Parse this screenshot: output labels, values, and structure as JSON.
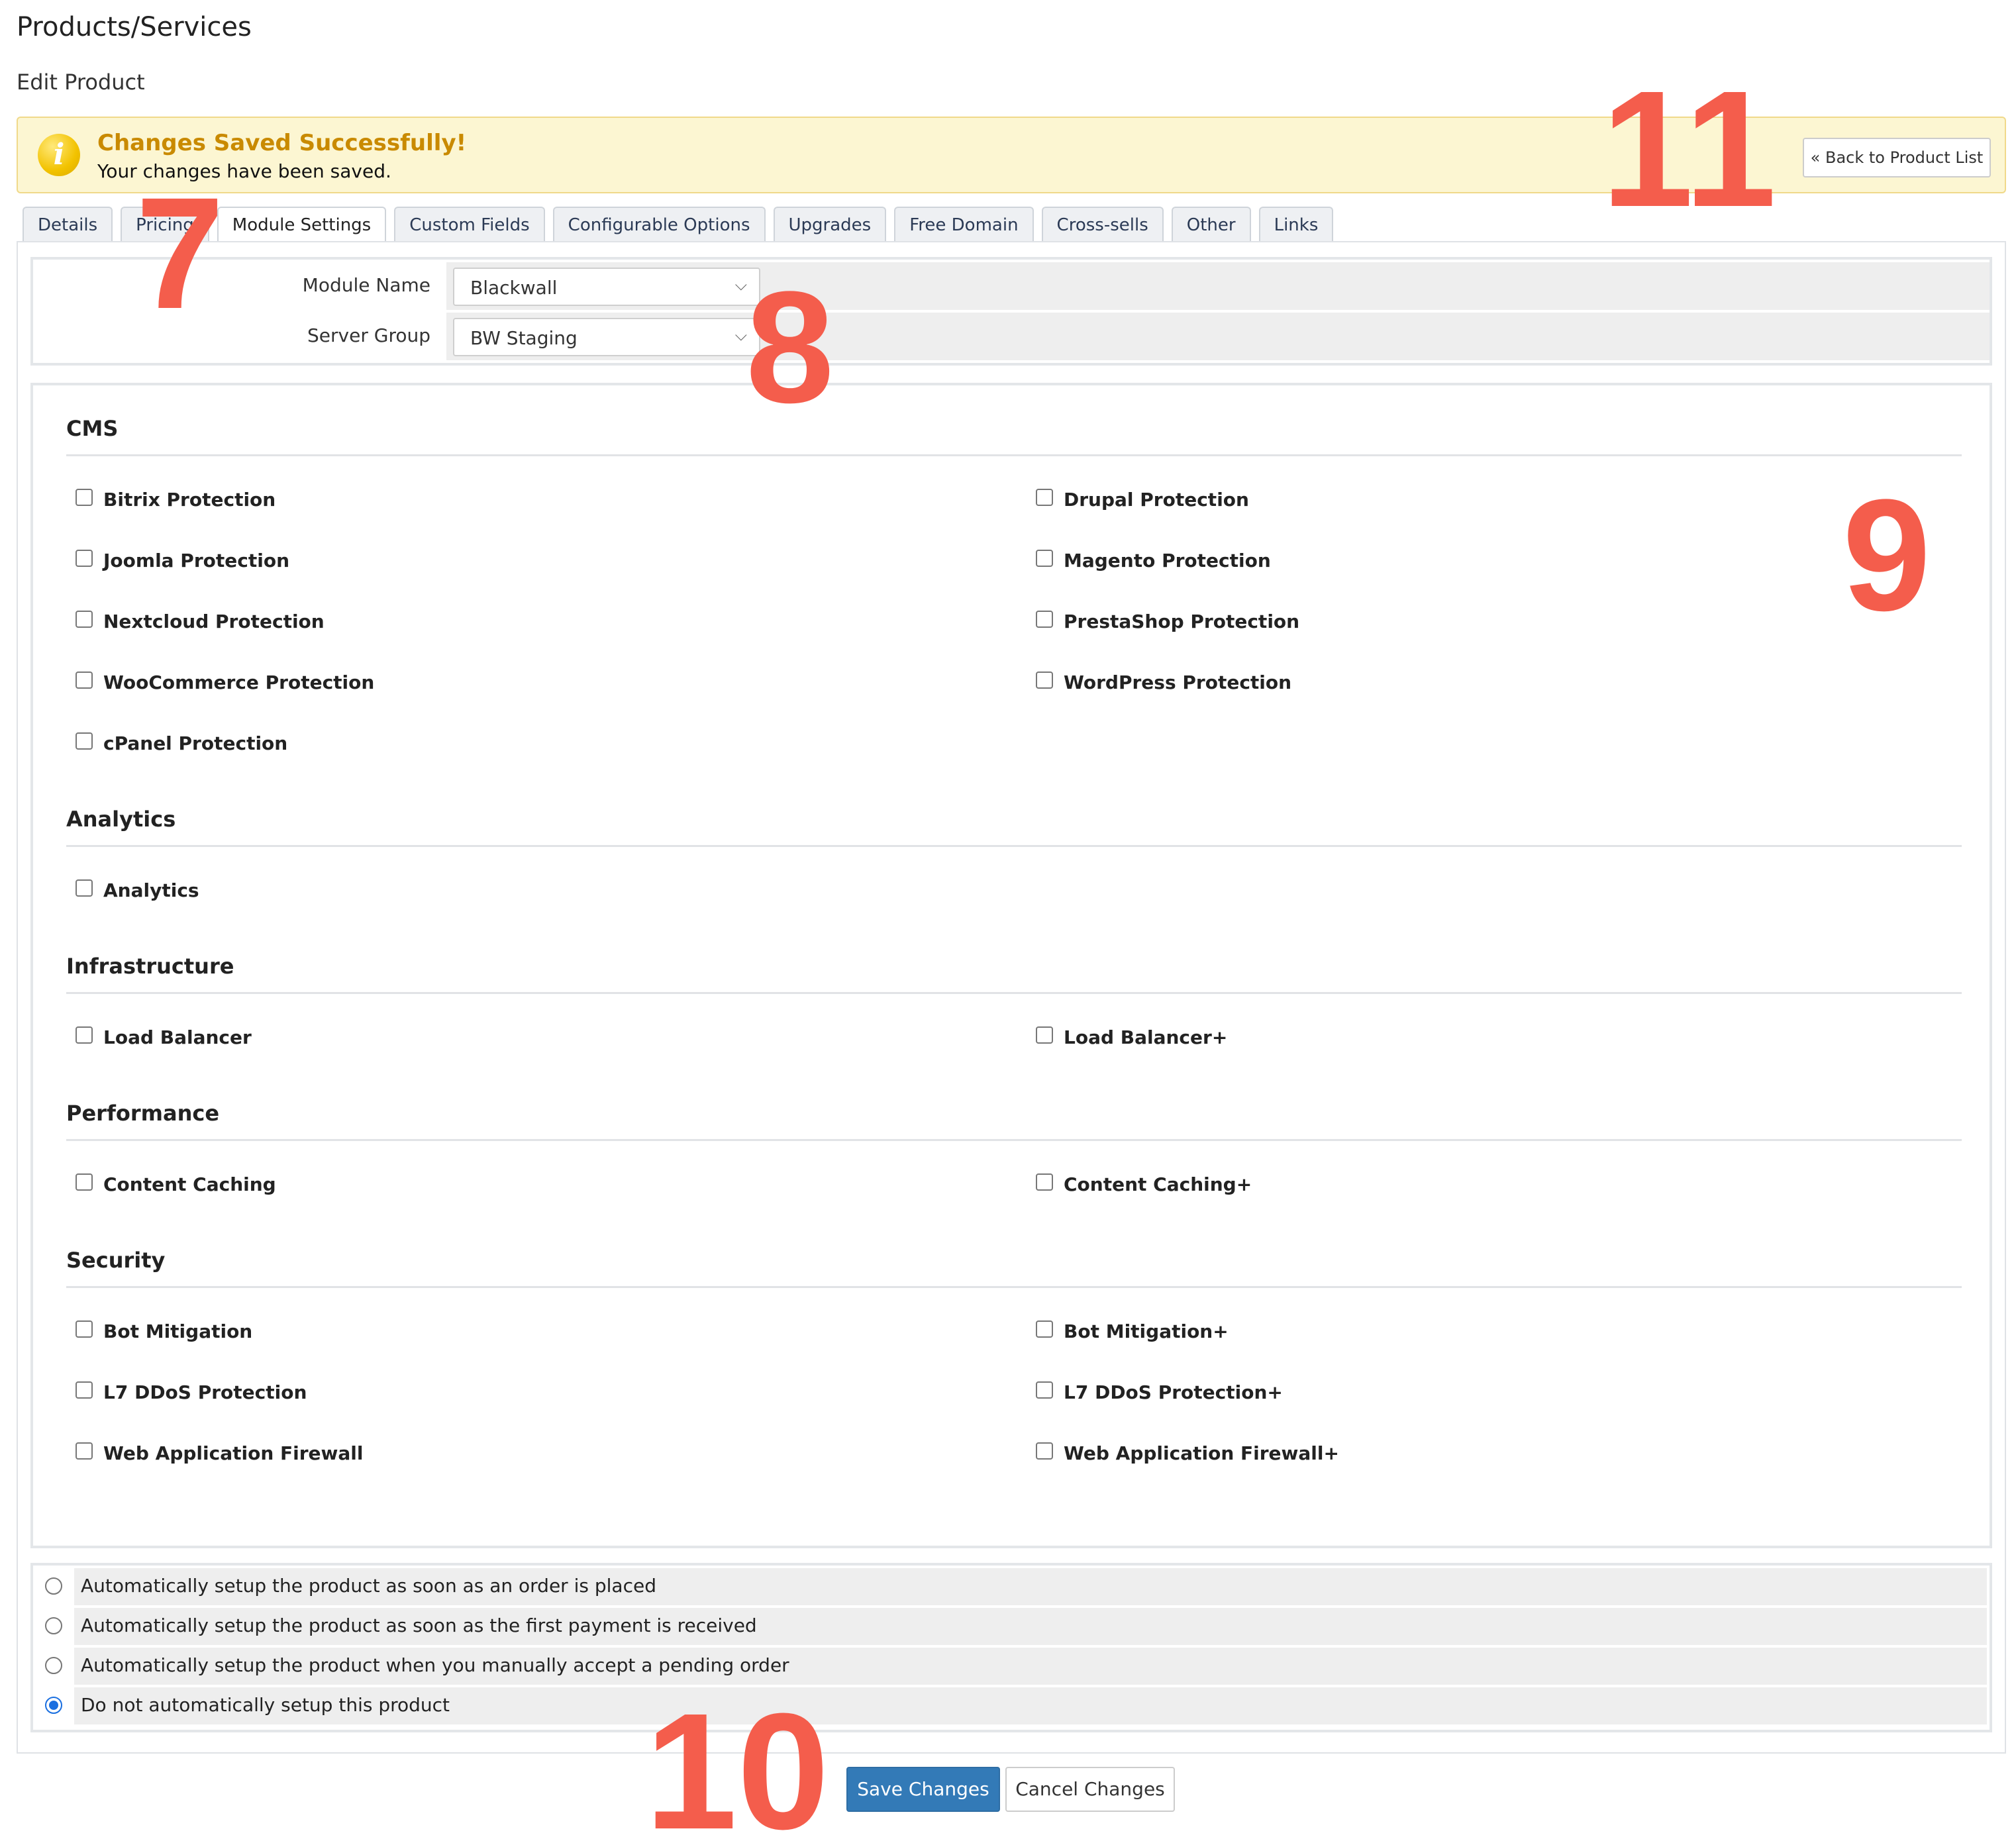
{
  "header": {
    "title": "Products/Services",
    "subtitle": "Edit Product"
  },
  "alert": {
    "icon": "info-icon",
    "title": "Changes Saved Successfully!",
    "message": "Your changes have been saved.",
    "back_label": "« Back to Product List"
  },
  "tabs": [
    {
      "label": "Details"
    },
    {
      "label": "Pricing"
    },
    {
      "label": "Module Settings",
      "active": true
    },
    {
      "label": "Custom Fields"
    },
    {
      "label": "Configurable Options"
    },
    {
      "label": "Upgrades"
    },
    {
      "label": "Free Domain"
    },
    {
      "label": "Cross-sells"
    },
    {
      "label": "Other"
    },
    {
      "label": "Links"
    }
  ],
  "module": {
    "module_name_label": "Module Name",
    "module_name_value": "Blackwall",
    "server_group_label": "Server Group",
    "server_group_value": "BW Staging"
  },
  "features": {
    "cms": {
      "title": "CMS",
      "left": [
        "Bitrix Protection",
        "Joomla Protection",
        "Nextcloud Protection",
        "WooCommerce Protection",
        "cPanel Protection"
      ],
      "right": [
        "Drupal Protection",
        "Magento Protection",
        "PrestaShop Protection",
        "WordPress Protection"
      ]
    },
    "analytics": {
      "title": "Analytics",
      "left": [
        "Analytics"
      ]
    },
    "infrastructure": {
      "title": "Infrastructure",
      "left": [
        "Load Balancer"
      ],
      "right": [
        "Load Balancer+"
      ]
    },
    "performance": {
      "title": "Performance",
      "left": [
        "Content Caching"
      ],
      "right": [
        "Content Caching+"
      ]
    },
    "security": {
      "title": "Security",
      "left": [
        "Bot Mitigation",
        "L7 DDoS Protection",
        "Web Application Firewall"
      ],
      "right": [
        "Bot Mitigation+",
        "L7 DDoS Protection+",
        "Web Application Firewall+"
      ]
    }
  },
  "setup_options": [
    {
      "label": "Automatically setup the product as soon as an order is placed",
      "checked": false
    },
    {
      "label": "Automatically setup the product as soon as the first payment is received",
      "checked": false
    },
    {
      "label": "Automatically setup the product when you manually accept a pending order",
      "checked": false
    },
    {
      "label": "Do not automatically setup this product",
      "checked": true
    }
  ],
  "buttons": {
    "save": "Save Changes",
    "cancel": "Cancel Changes"
  },
  "annotations": [
    "7",
    "8",
    "9",
    "10",
    "11"
  ],
  "colors": {
    "annotation": "#f45d4c",
    "primary": "#337ab7",
    "alert_bg": "#fcf6d2",
    "alert_title": "#c98a00"
  }
}
